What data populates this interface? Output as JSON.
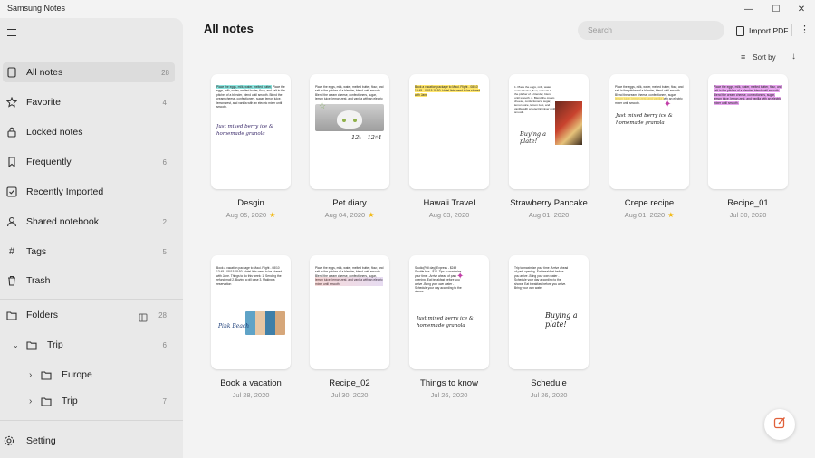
{
  "app": {
    "title": "Samsung Notes"
  },
  "sidebar": {
    "nav": [
      {
        "label": "All notes",
        "count": "28",
        "icon": "notes-icon"
      },
      {
        "label": "Favorite",
        "count": "4",
        "icon": "star-icon"
      },
      {
        "label": "Locked notes",
        "count": "",
        "icon": "lock-icon"
      },
      {
        "label": "Frequently",
        "count": "6",
        "icon": "bookmark-icon"
      },
      {
        "label": "Recently Imported",
        "count": "",
        "icon": "import-icon"
      },
      {
        "label": "Shared notebook",
        "count": "2",
        "icon": "person-icon"
      },
      {
        "label": "Tags",
        "count": "5",
        "icon": "hash-icon"
      },
      {
        "label": "Trash",
        "count": "",
        "icon": "trash-icon"
      }
    ],
    "folders": {
      "label": "Folders",
      "count": "28"
    },
    "folder_items": [
      {
        "label": "Trip",
        "count": "6"
      },
      {
        "label": "Europe",
        "count": ""
      },
      {
        "label": "Trip",
        "count": "7"
      }
    ],
    "setting": "Setting"
  },
  "header": {
    "title": "All notes",
    "search_placeholder": "Search",
    "import_label": "Import PDF",
    "sort_label": "Sort by"
  },
  "notes": [
    {
      "title": "Desgin",
      "date": "Aug 05, 2020",
      "favorite": true
    },
    {
      "title": "Pet diary",
      "date": "Aug 04, 2020",
      "favorite": true
    },
    {
      "title": "Hawaii Travel",
      "date": "Aug 03, 2020",
      "favorite": false
    },
    {
      "title": "Strawberry Pancake",
      "date": "Aug 01, 2020",
      "favorite": false
    },
    {
      "title": "Crepe recipe",
      "date": "Aug 01, 2020",
      "favorite": true
    },
    {
      "title": "Recipe_01",
      "date": "Jul 30, 2020",
      "favorite": false
    },
    {
      "title": "Book a vacation",
      "date": "Jul 28, 2020",
      "favorite": false
    },
    {
      "title": "Recipe_02",
      "date": "Jul 30, 2020",
      "favorite": false
    },
    {
      "title": "Things to know",
      "date": "Jul 26, 2020",
      "favorite": false
    },
    {
      "title": "Schedule",
      "date": "Jul 26, 2020",
      "favorite": false
    }
  ],
  "previews": {
    "recipe": "Place the eggs, milk, water, melted butter, flour, and salt in the pitcher of a blender, blend until smooth. Blend the cream cheese, confectioners, sugar, lemon juice, lemon zest, and vanilla with an electric mixer until smooth.",
    "handwriting1": "Just mixed berry ice & homemade granola",
    "pet_caption": "12♭ - 12♯4",
    "hawaii": "Book a vacation package to Maui. Flight - 08/10 13:45 - 08/15 18:50. Hotel lists need to be shared with Jane",
    "pancake": "1. Place the eggs, milk, water, melted butter, flour, and salt in the pitcher of a blender, blend until smooth. 2. Blend the cream cheese, confectioners, sugar, lemon juice, lemon zest, and vanilla with an electric mixer until smooth.",
    "buying": "Buying a plate!",
    "vacation": "Book a vacation package to Maui. Flight - 08/10 13:45 - 08/15 18:50. Hotel lists need to be shared with Jane. Things to do this week: 1. Sending the refund mail 2. Buying a pill case 3. Making a reservation",
    "pink_beach": "Pink Beach",
    "things": "Studio(Full day) Express - $249 Shuttle bus - $10. Tips to maximize your time: -Arrive ahead of park opening -Eat breakfast before you arrive -Bring your own water -Schedule your day according to the shows",
    "schedule": "Trip to maximize your time -Arrive ahead of park opening -Eat breakfast before you arrive -Bring your own water -Schedule your day according to the shows. Eat breakfast before you arrive. Bring your own water"
  },
  "colors": {
    "accent": "#e0603a",
    "star": "#f2b400",
    "highlight_cyan": "#8ee6e0",
    "highlight_yellow": "#ffe66b",
    "highlight_pink": "#e9a6f0"
  }
}
